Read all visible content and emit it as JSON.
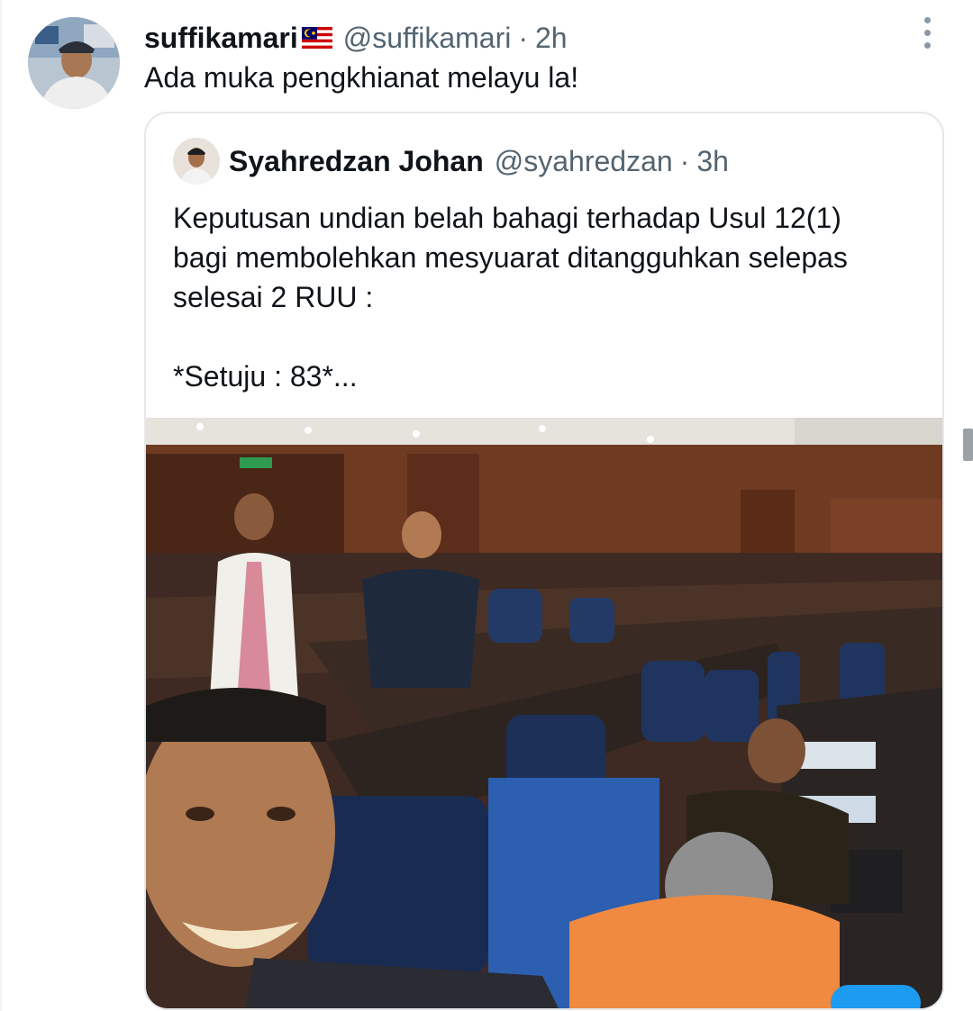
{
  "tweet": {
    "display_name": "suffikamari",
    "flag_icon": "malaysia-flag-icon",
    "handle": "@suffikamari",
    "separator": "·",
    "time": "2h",
    "text": "Ada muka pengkhianat melayu la!"
  },
  "quoted_tweet": {
    "display_name": "Syahredzan Johan",
    "handle": "@syahredzan",
    "separator": "·",
    "time": "3h",
    "text_lines": [
      "Keputusan undian belah bahagi terhadap Usul 12(1)",
      "bagi membolehkan mesyuarat ditangguhkan selepas",
      "selesai 2 RUU :",
      "",
      "*Setuju : 83*..."
    ]
  },
  "colors": {
    "text_primary": "#0f1419",
    "text_secondary": "#536471",
    "border": "#e3e8eb",
    "accent": "#1d9bf0"
  }
}
